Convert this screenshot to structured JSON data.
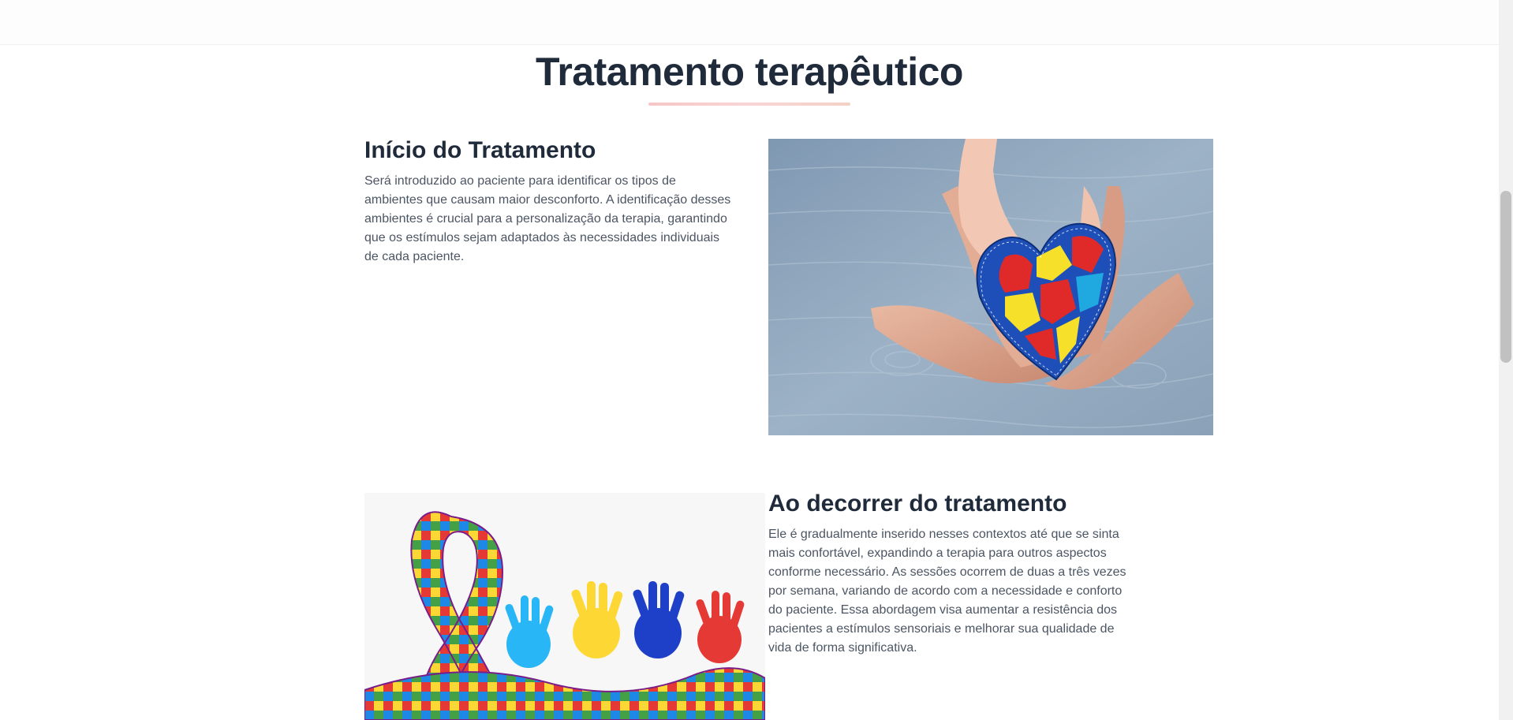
{
  "section": {
    "title": "Tratamento terapêutico"
  },
  "blocks": [
    {
      "heading": "Início do Tratamento",
      "paragraph": "Será introduzido ao paciente para identificar os tipos de ambientes que causam maior desconforto. A identificação desses ambientes é crucial para a personalização da terapia, garantindo que os estímulos sejam adaptados às necessidades individuais de cada paciente.",
      "image": "hands-holding-puzzle-heart-photo"
    },
    {
      "heading": "Ao decorrer do tratamento",
      "paragraph": "Ele é gradualmente inserido nesses contextos até que se sinta mais confortável, expandindo a terapia para outros aspectos conforme necessário. As sessões ocorrem de duas a três vezes por semana, variando de acordo com a necessidade e conforto do paciente. Essa abordagem visa aumentar a resistência dos pacientes a estímulos sensoriais e melhorar sua qualidade de vida de forma significativa.",
      "image": "puzzle-ribbon-colored-hands-photo"
    }
  ],
  "colors": {
    "heading": "#1f2a3a",
    "body_text": "#4b5563",
    "underline": "#f6c6c6",
    "wood": "#8fa6bd"
  }
}
